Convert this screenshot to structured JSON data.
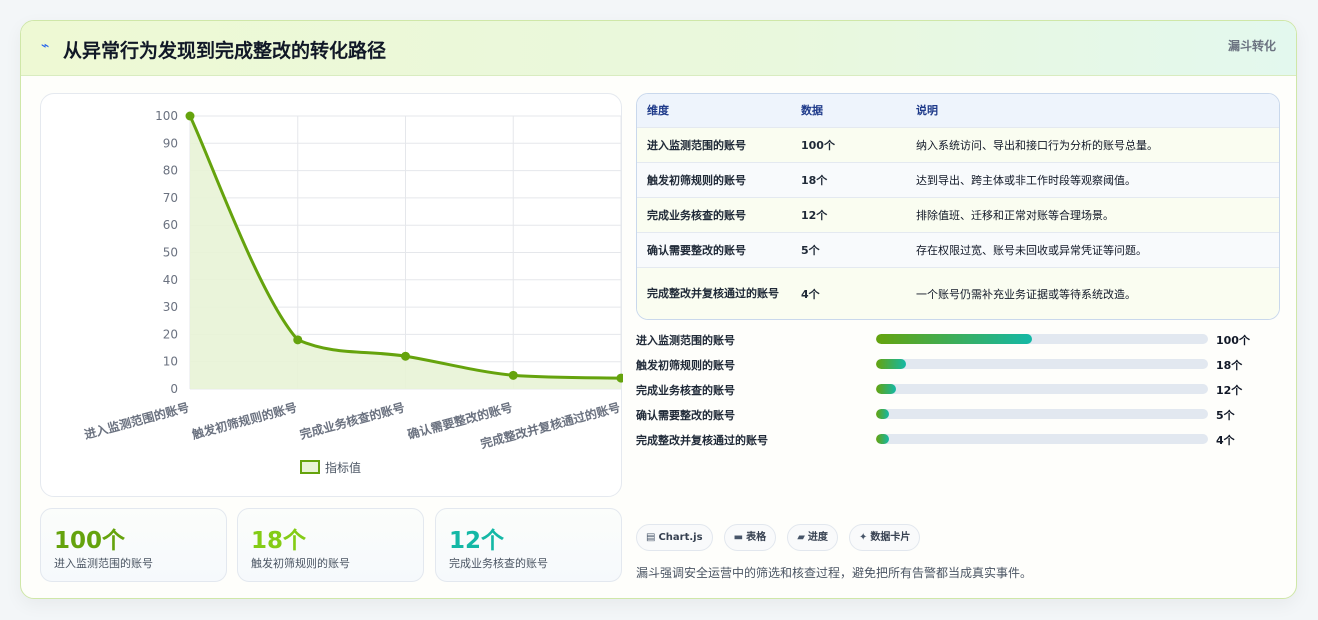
{
  "header": {
    "title": "从异常行为发现到完成整改的转化路径",
    "tag": "漏斗转化",
    "icon": "spark-icon"
  },
  "chart_data": {
    "type": "line",
    "categories": [
      "进入监测范围的账号",
      "触发初筛规则的账号",
      "完成业务核查的账号",
      "确认需要整改的账号",
      "完成整改并复核通过的账号"
    ],
    "series": [
      {
        "name": "指标值",
        "values": [
          100,
          18,
          12,
          5,
          4
        ]
      }
    ],
    "ylim": [
      0,
      100
    ],
    "yticks": [
      0,
      10,
      20,
      30,
      40,
      50,
      60,
      70,
      80,
      90,
      100
    ],
    "grid": true,
    "legend_position": "bottom",
    "line_color": "#65a30d",
    "fill_color": "#e8f3d6"
  },
  "kpis": [
    {
      "value": "100个",
      "label": "进入监测范围的账号",
      "color": "#65a30d"
    },
    {
      "value": "18个",
      "label": "触发初筛规则的账号",
      "color": "#84cc16"
    },
    {
      "value": "12个",
      "label": "完成业务核查的账号",
      "color": "#14b8a6"
    }
  ],
  "table": {
    "headers": [
      "维度",
      "数据",
      "说明"
    ],
    "rows": [
      {
        "dim": "进入监测范围的账号",
        "data": "100个",
        "desc": "纳入系统访问、导出和接口行为分析的账号总量。"
      },
      {
        "dim": "触发初筛规则的账号",
        "data": "18个",
        "desc": "达到导出、跨主体或非工作时段等观察阈值。"
      },
      {
        "dim": "完成业务核查的账号",
        "data": "12个",
        "desc": "排除值班、迁移和正常对账等合理场景。"
      },
      {
        "dim": "确认需要整改的账号",
        "data": "5个",
        "desc": "存在权限过宽、账号未回收或异常凭证等问题。"
      },
      {
        "dim": "完成整改并复核通过的账号",
        "data": "4个",
        "desc": "一个账号仍需补充业务证据或等待系统改造。"
      }
    ]
  },
  "progress": [
    {
      "label": "进入监测范围的账号",
      "value": "100个",
      "fraction": 0.47
    },
    {
      "label": "触发初筛规则的账号",
      "value": "18个",
      "fraction": 0.09
    },
    {
      "label": "完成业务核查的账号",
      "value": "12个",
      "fraction": 0.06
    },
    {
      "label": "确认需要整改的账号",
      "value": "5个",
      "fraction": 0.04
    },
    {
      "label": "完成整改并复核通过的账号",
      "value": "4个",
      "fraction": 0.04
    }
  ],
  "chips": [
    {
      "icon": "chart-icon",
      "glyph": "▤",
      "label": "Chart.js"
    },
    {
      "icon": "table-icon",
      "glyph": "▬",
      "label": "表格"
    },
    {
      "icon": "progress-icon",
      "glyph": "▰",
      "label": "进度"
    },
    {
      "icon": "card-icon",
      "glyph": "✦",
      "label": "数据卡片"
    }
  ],
  "footnote": "漏斗强调安全运营中的筛选和核查过程，避免把所有告警都当成真实事件。"
}
